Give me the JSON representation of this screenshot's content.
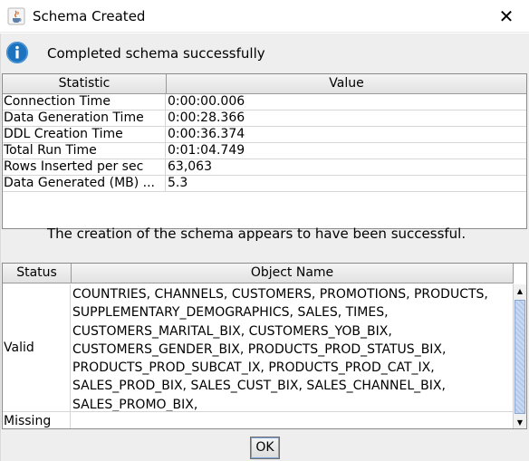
{
  "window": {
    "title": "Schema Created",
    "close_glyph": "✕"
  },
  "message": "Completed schema successfully",
  "statistics": {
    "headers": [
      "Statistic",
      "Value"
    ],
    "rows": [
      {
        "statistic": "Connection Time",
        "value": "0:00:00.006"
      },
      {
        "statistic": "Data Generation Time",
        "value": "0:00:28.366"
      },
      {
        "statistic": "DDL Creation Time",
        "value": "0:00:36.374"
      },
      {
        "statistic": "Total Run Time",
        "value": "0:01:04.749"
      },
      {
        "statistic": "Rows Inserted per sec",
        "value": "63,063"
      },
      {
        "statistic": "Data Generated (MB) ...",
        "value": "5.3"
      }
    ]
  },
  "result_message": "The creation of the schema appears to have been successful.",
  "objects": {
    "headers": [
      "Status",
      "Object Name"
    ],
    "rows": [
      {
        "status": "Valid",
        "lines": [
          "COUNTRIES, CHANNELS, CUSTOMERS, PROMOTIONS, PRODUCTS,",
          "SUPPLEMENTARY_DEMOGRAPHICS, SALES, TIMES,",
          "CUSTOMERS_MARITAL_BIX, CUSTOMERS_YOB_BIX,",
          "CUSTOMERS_GENDER_BIX, PRODUCTS_PROD_STATUS_BIX,",
          "PRODUCTS_PROD_SUBCAT_IX, PRODUCTS_PROD_CAT_IX,",
          "SALES_PROD_BIX, SALES_CUST_BIX, SALES_CHANNEL_BIX,",
          "SALES_PROMO_BIX,"
        ]
      },
      {
        "status": "Missing",
        "lines": []
      }
    ]
  },
  "scrollbar": {
    "up_glyph": "▲",
    "down_glyph": "▼"
  },
  "ok_label": "OK",
  "colors": {
    "info_icon": "#1e73be",
    "dialog_bg": "#eeeeee"
  }
}
